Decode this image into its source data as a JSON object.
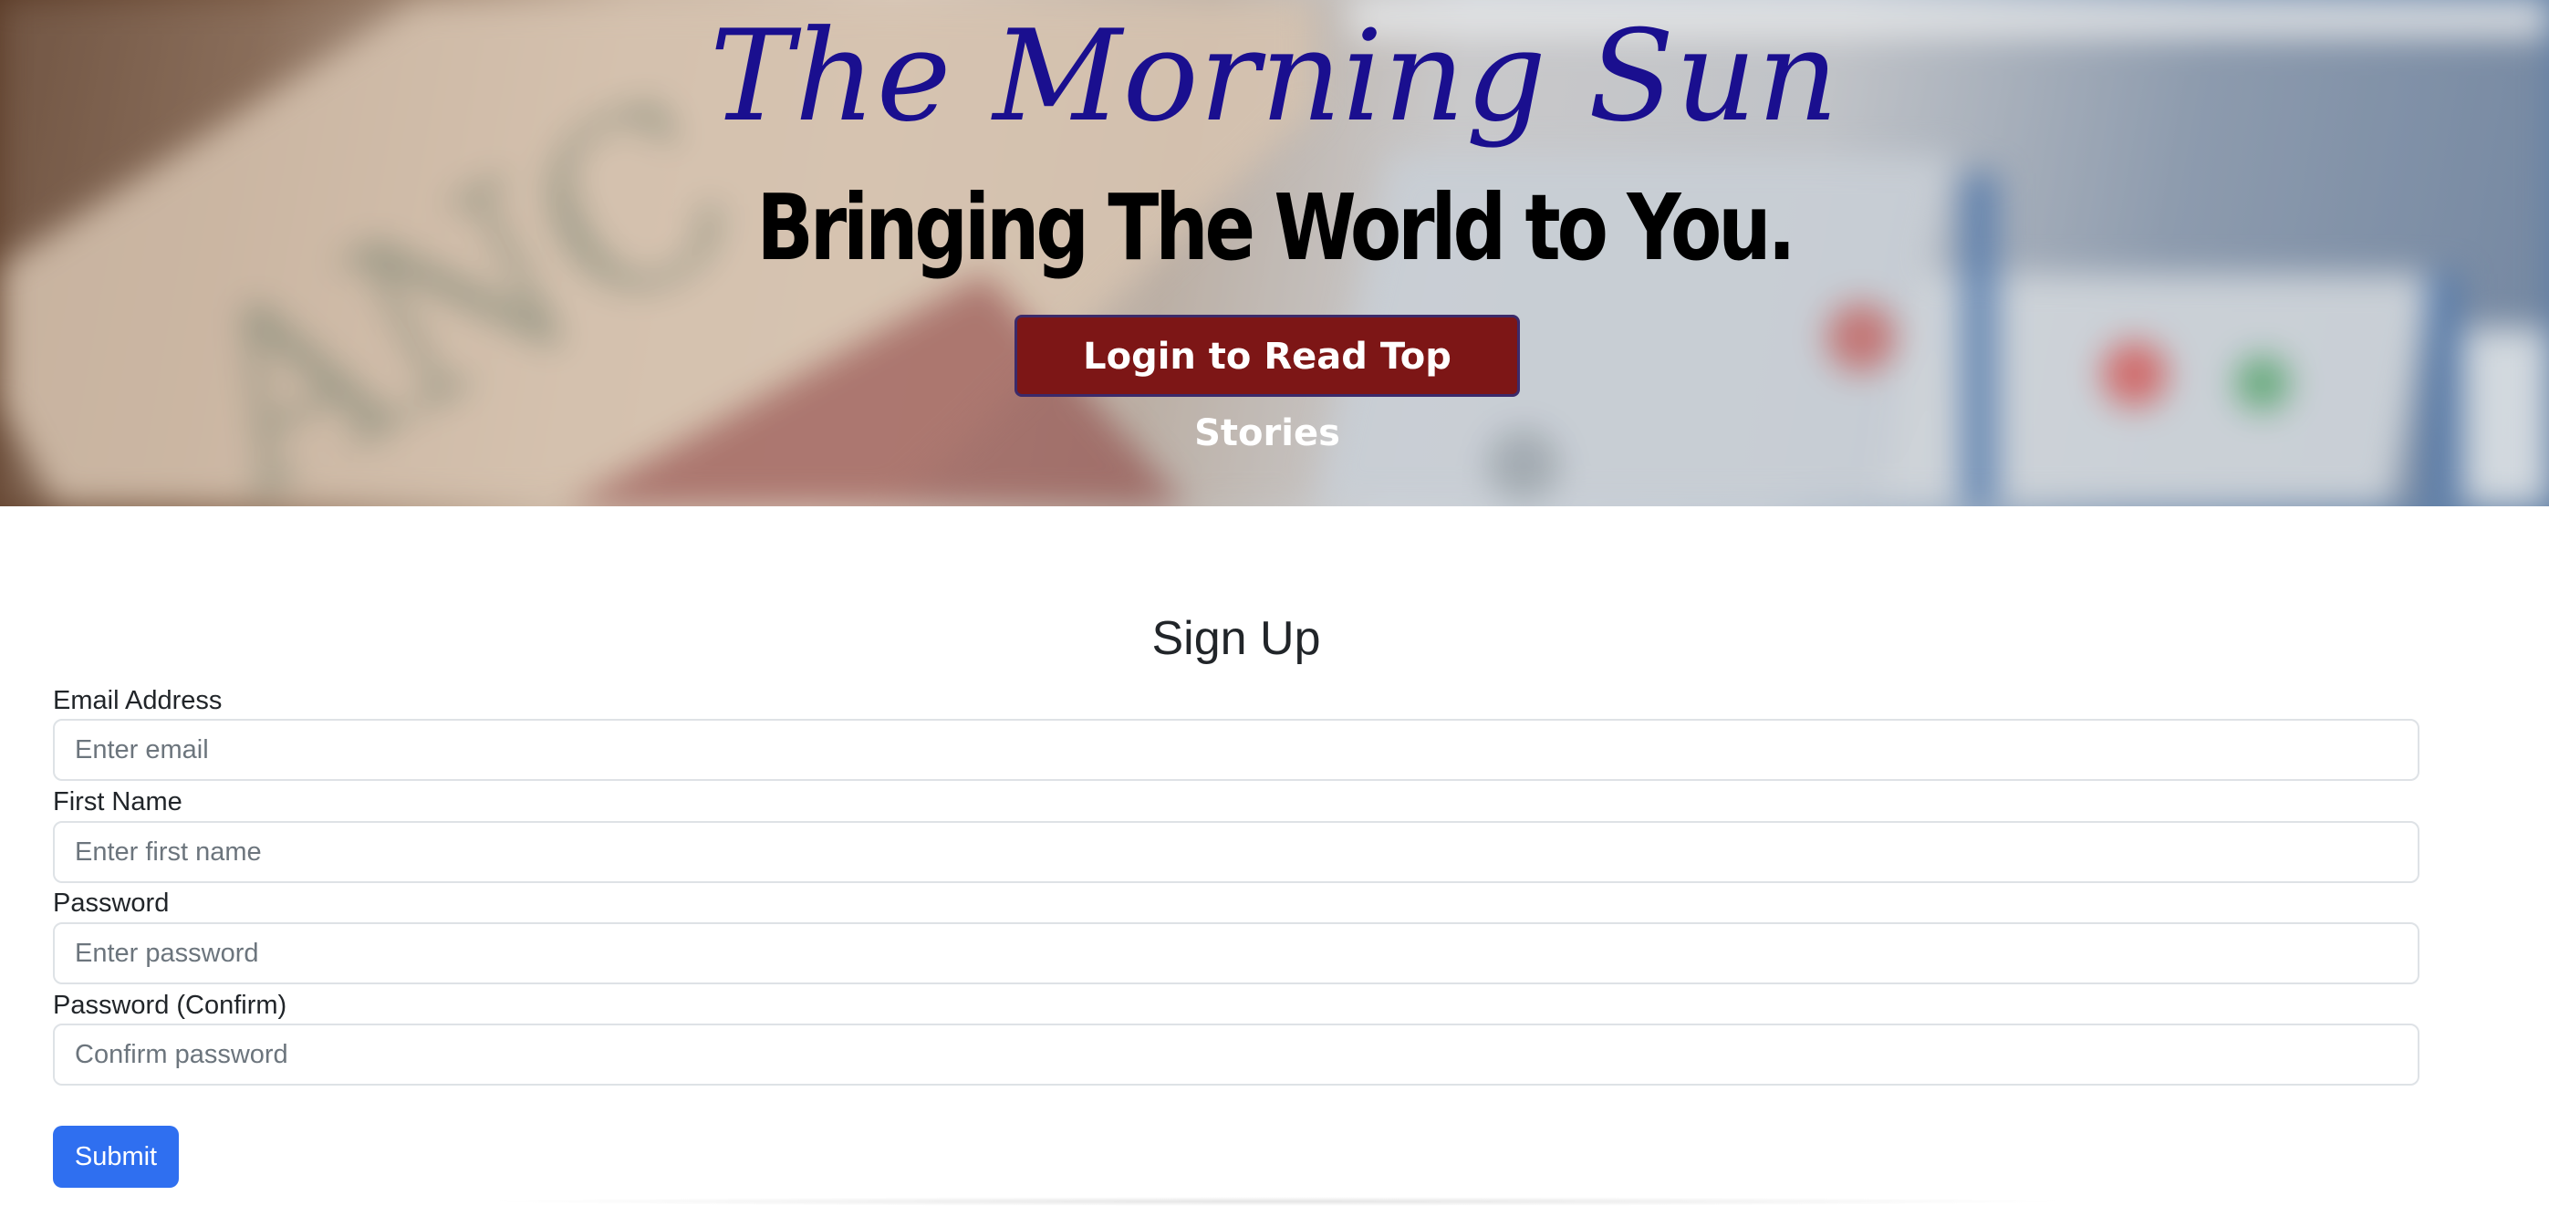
{
  "hero": {
    "brand_title": "The Morning Sun",
    "tagline": "Bringing The World to You.",
    "login_button": "Login to Read Top Stories"
  },
  "signup": {
    "heading": "Sign Up",
    "fields": [
      {
        "label": "Email Address",
        "placeholder": "Enter email",
        "value": ""
      },
      {
        "label": "First Name",
        "placeholder": "Enter first name",
        "value": ""
      },
      {
        "label": "Password",
        "placeholder": "Enter password",
        "value": ""
      },
      {
        "label": "Password (Confirm)",
        "placeholder": "Confirm password",
        "value": ""
      }
    ],
    "submit_button": "Submit"
  },
  "colors": {
    "brand_title": "#1a0f8f",
    "login_button_bg": "#7d1616",
    "submit_button_bg": "#2f6ff0"
  },
  "icons": {
    "hero_background": "blurred-newspaper-and-tablet-photo"
  }
}
